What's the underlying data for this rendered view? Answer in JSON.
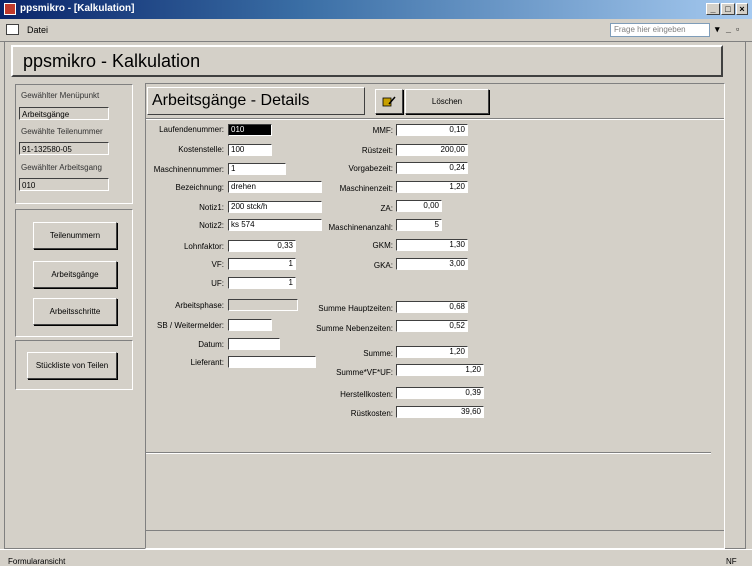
{
  "window": {
    "title": "ppsmikro - [Kalkulation]"
  },
  "menu": {
    "file": "Datei",
    "ask_placeholder": "Frage hier eingeben"
  },
  "header": {
    "title": "ppsmikro - Kalkulation"
  },
  "left_panel": {
    "menu_label": "Gewählter Menüpunkt",
    "menu_value": "Arbeitsgänge",
    "part_label": "Gewählte Teilenummer",
    "part_value": "91-132580-05",
    "op_label": "Gewählter Arbeitsgang",
    "op_value": "010",
    "nav": [
      "Teilenummern",
      "Arbeitsgänge",
      "Arbeitsschritte"
    ],
    "bom": "Stückliste von Teilen"
  },
  "details": {
    "title": "Arbeitsgänge - Details",
    "delete_button": "Löschen",
    "left_fields": [
      {
        "label": "Laufendenummer:",
        "value": "010"
      },
      {
        "label": "Kostenstelle:",
        "value": "100"
      },
      {
        "label": "Maschinennummer:",
        "value": "1"
      },
      {
        "label": "Bezeichnung:",
        "value": "drehen"
      },
      {
        "label": "Notiz1:",
        "value": "200 stck/h"
      },
      {
        "label": "Notiz2:",
        "value": "ks 574"
      },
      {
        "label": "Lohnfaktor:",
        "value": "0,33"
      },
      {
        "label": "VF:",
        "value": "1"
      },
      {
        "label": "UF:",
        "value": "1"
      },
      {
        "label": "Arbeitsphase:",
        "value": ""
      },
      {
        "label": "SB / Weitermelder:",
        "value": ""
      },
      {
        "label": "Datum:",
        "value": ""
      },
      {
        "label": "Lieferant:",
        "value": ""
      }
    ],
    "right_fields": [
      {
        "label": "MMF:",
        "value": "0,10"
      },
      {
        "label": "Rüstzeit:",
        "value": "200,00"
      },
      {
        "label": "Vorgabezeit:",
        "value": "0,24"
      },
      {
        "label": "Maschinenzeit:",
        "value": "1,20"
      },
      {
        "label": "ZA:",
        "value": "0,00"
      },
      {
        "label": "Maschinenanzahl:",
        "value": "5"
      },
      {
        "label": "GKM:",
        "value": "1,30"
      },
      {
        "label": "GKA:",
        "value": "3,00"
      }
    ],
    "sum_fields": [
      {
        "label": "Summe Hauptzeiten:",
        "value": "0,68"
      },
      {
        "label": "Summe Nebenzeiten:",
        "value": "0,52"
      },
      {
        "label": "Summe:",
        "value": "1,20"
      },
      {
        "label": "Summe*VF*UF:",
        "value": "1,20"
      },
      {
        "label": "Herstellkosten:",
        "value": "0,39"
      },
      {
        "label": "Rüstkosten:",
        "value": "39,60"
      }
    ]
  },
  "status": {
    "left": "Formularansicht",
    "right": "NF"
  }
}
